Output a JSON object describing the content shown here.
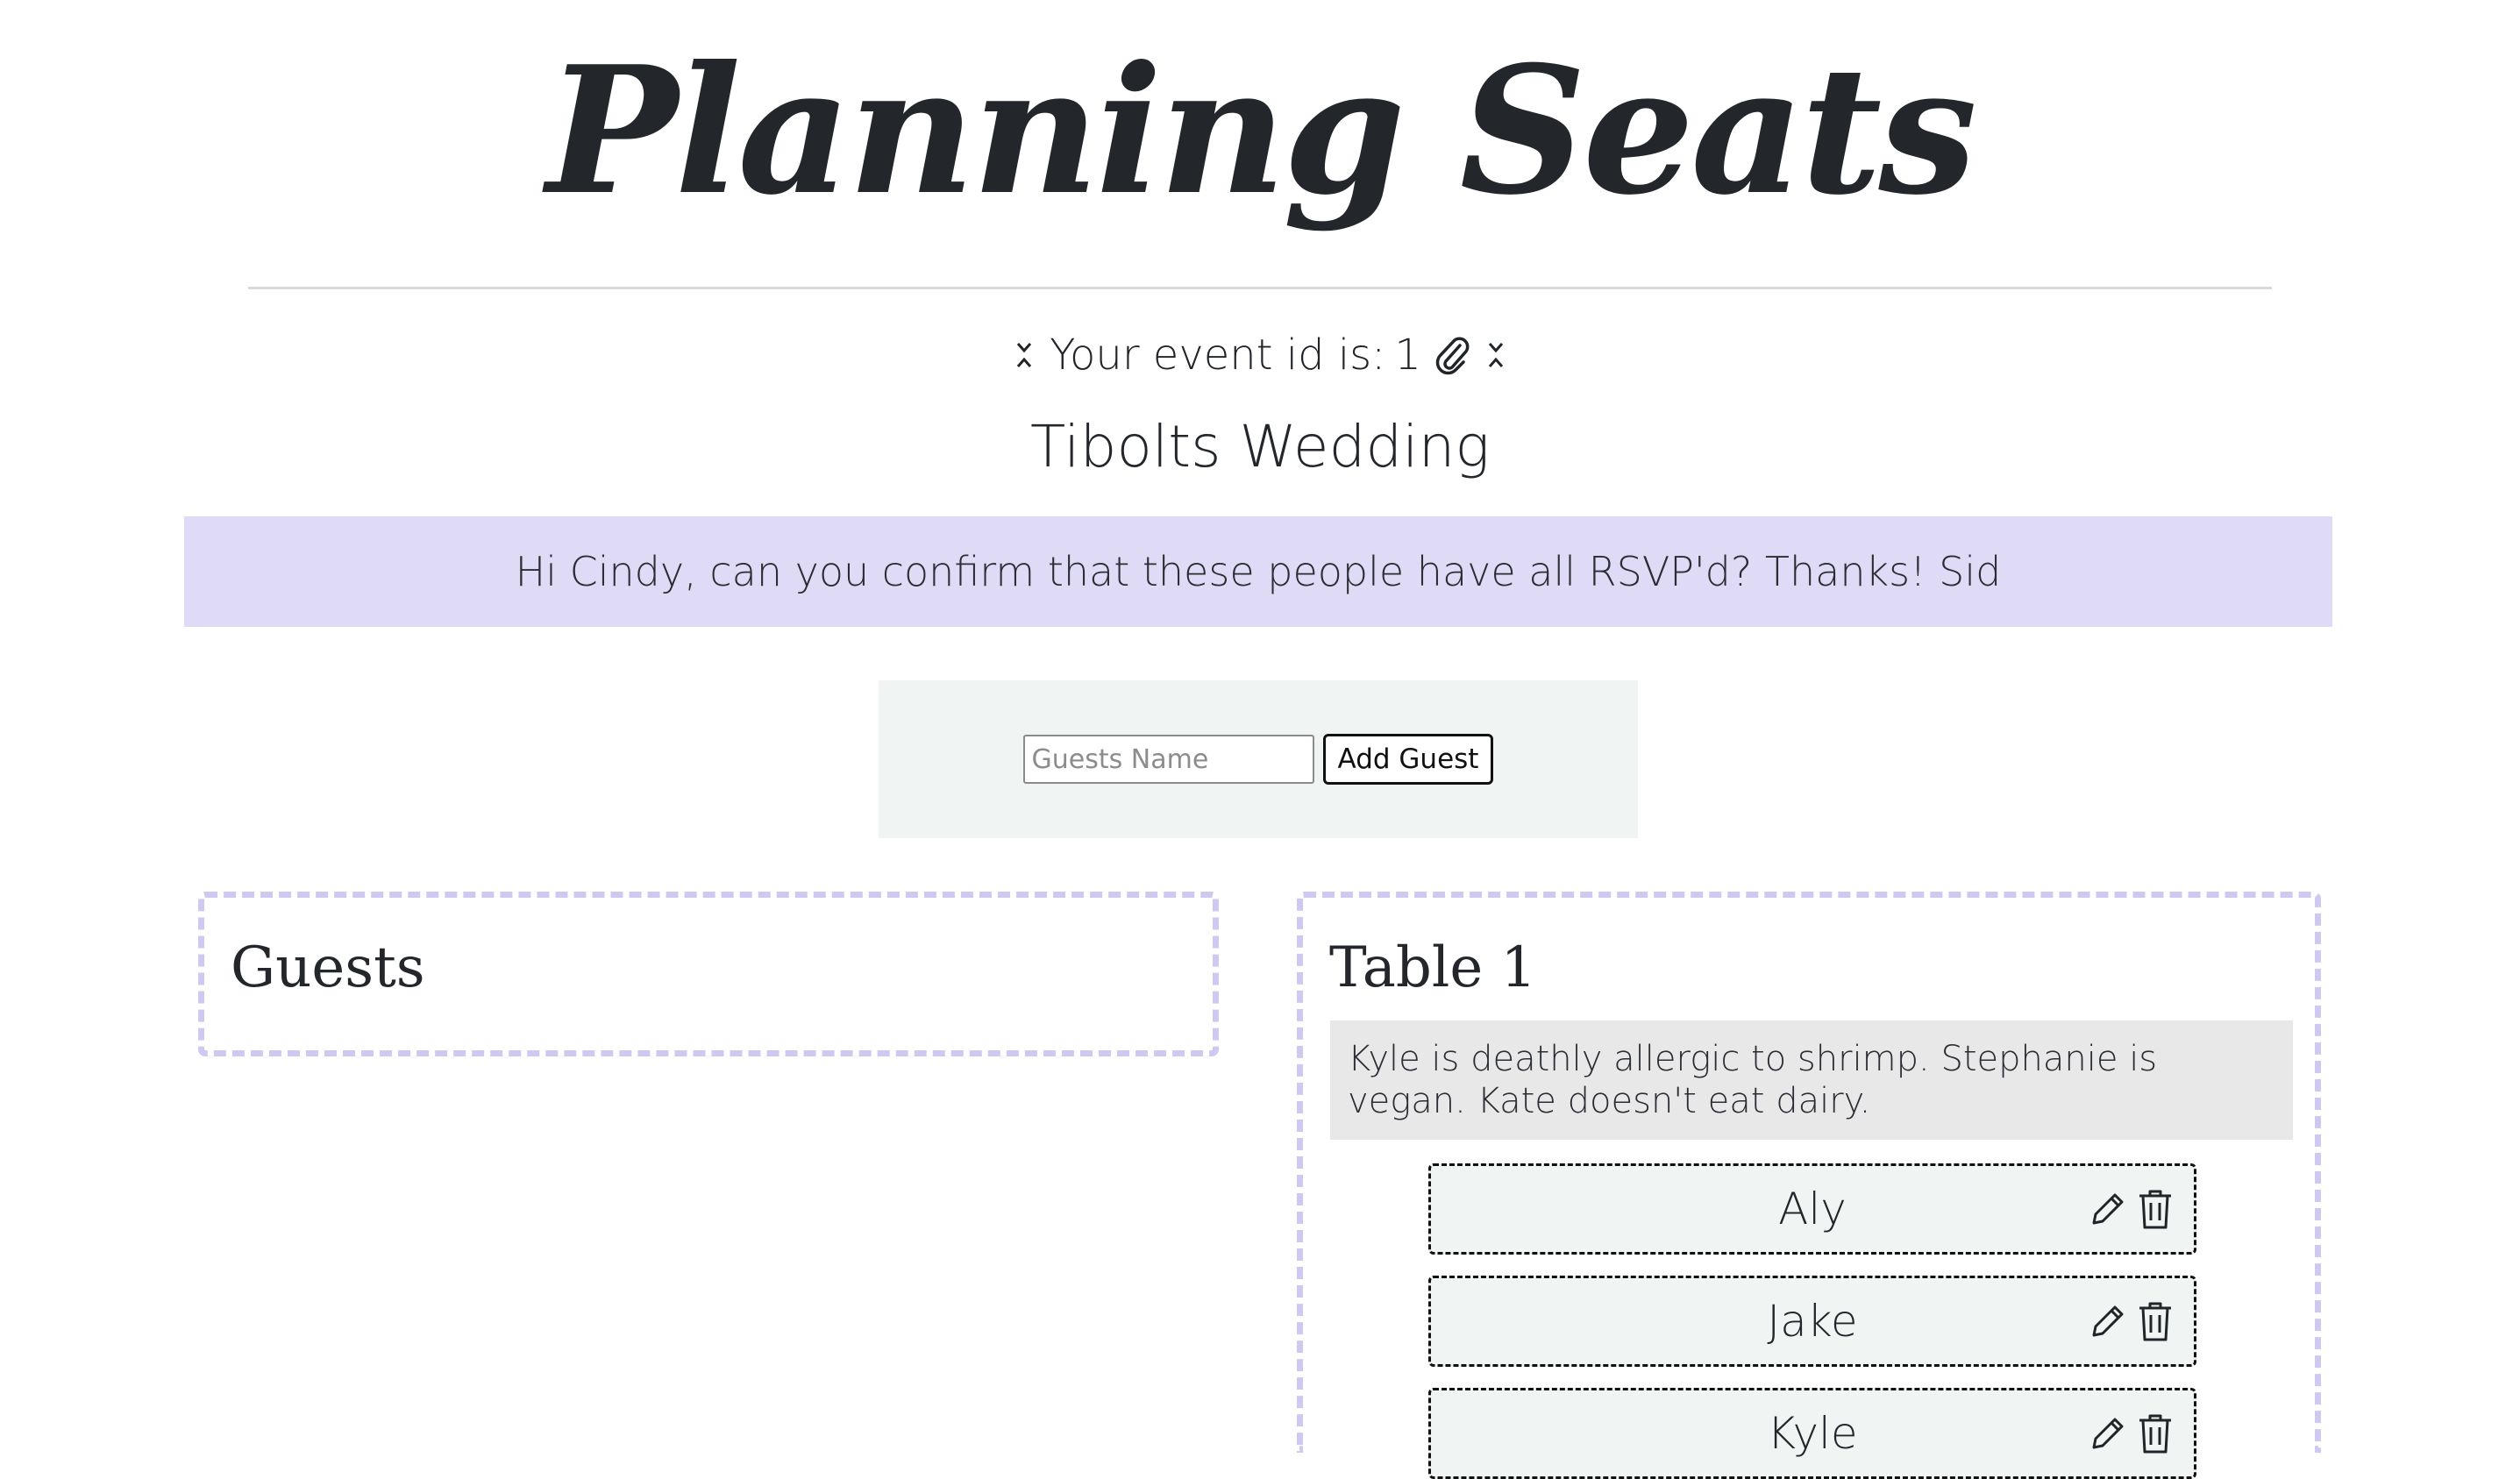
{
  "app": {
    "title": "Planning Seats"
  },
  "event": {
    "id_label": "Your event id is:",
    "id_value": "1",
    "name": "Tibolts Wedding",
    "note": "Hi Cindy, can you confirm that these people have all RSVP'd? Thanks! Sid"
  },
  "add_guest": {
    "placeholder": "Guests Name",
    "value": "",
    "button_label": "Add Guest"
  },
  "guests_panel": {
    "heading": "Guests"
  },
  "tables": [
    {
      "heading": "Table 1",
      "note": "Kyle is deathly allergic to shrimp. Stephanie is vegan. Kate doesn't eat dairy.",
      "seats": [
        {
          "name": "Aly"
        },
        {
          "name": "Jake"
        },
        {
          "name": "Kyle"
        }
      ]
    }
  ],
  "icons": {
    "collapse": "chevrons-collapse-icon",
    "copy": "paperclip-icon",
    "edit": "pencil-icon",
    "delete": "trash-icon"
  },
  "colors": {
    "banner": "#dfdaf5",
    "panel": "#f0f5f3",
    "dashed_border": "#cfc9f2",
    "note_bg": "#e9e8e9"
  }
}
